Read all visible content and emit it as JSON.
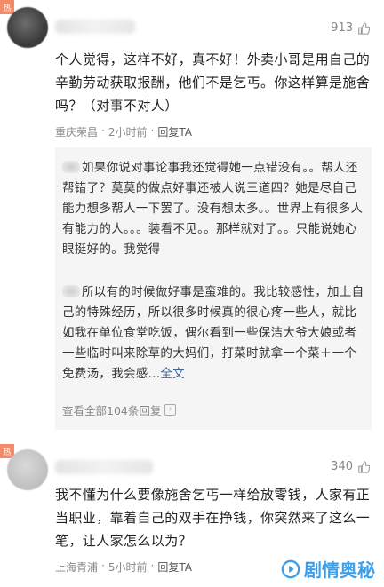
{
  "comments": [
    {
      "badge": "热",
      "likes": "913",
      "text": "个人觉得，这样不好，真不好！外卖小哥是用自己的辛勤劳动获取报酬，他们不是乞丐。你这样算是施舍吗？（对事不对人）",
      "location": "重庆荣昌",
      "time": "2小时前",
      "reply_label": "回复TA",
      "replies": [
        {
          "text": "如果你说对事论事我还觉得她一点错没有。。帮人还帮错了？莫莫的做点好事还被人说三道四？她是尽自己能力想多帮人一下罢了。没有想太多。。世界上有很多人有能力的人。。。装看不见。。那样就对了。。只能说她心眼挺好的。我觉得"
        },
        {
          "text": "所以有的时候做好事是蛮难的。我比较感性，加上自己的特殊经历，所以很多时候真的很心疼一些人，就比如我在单位食堂吃饭，偶尔看到一些保洁大爷大娘或者一些临时叫来除草的大妈们，打菜时就拿一个菜＋一个免费汤，我会感...",
          "more": "全文"
        }
      ],
      "view_all": "查看全部104条回复"
    },
    {
      "badge": "热",
      "likes": "340",
      "text": "我不懂为什么要像施舍乞丐一样给放零钱，人家有正当职业，靠着自己的双手在挣钱，你突然来了这么一笔，让人家怎么以为？",
      "location": "上海青浦",
      "time": "5小时前",
      "reply_label": "回复TA"
    }
  ],
  "watermark": "剧情奥秘",
  "colors": {
    "badge": "#f38b69",
    "link": "#406599",
    "watermark": "#1c8fe6"
  },
  "icons": {
    "like": "thumbs-up-icon",
    "reply_list": "reply-list-icon",
    "watermark": "play-icon"
  }
}
